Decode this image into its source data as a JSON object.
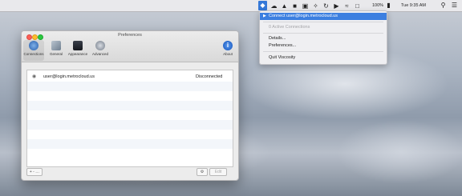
{
  "menubar": {
    "battery": "100%",
    "clock": "Tue 9:35 AM",
    "status_icons": [
      "viscosity-icon",
      "cloud-icon",
      "shield-icon",
      "dropbox-icon",
      "display-icon",
      "bluetooth-icon",
      "timemachine-icon",
      "volume-icon",
      "wifi-icon",
      "input-icon"
    ]
  },
  "dropdown": {
    "connect_item": "Connect user@login.metrocloud.us",
    "active_connections": "0 Active Connections",
    "details": "Details...",
    "preferences": "Preferences...",
    "quit": "Quit Viscosity"
  },
  "window": {
    "title": "Preferences",
    "toolbar": {
      "connections": "Connections",
      "general": "General",
      "appearance": "Appearance",
      "advanced": "Advanced",
      "about": "About"
    },
    "connections": [
      {
        "name": "user@login.metrocloud.us",
        "status": "Disconnected"
      }
    ],
    "bottom": {
      "add_remove": "+ - …",
      "settings": "⚙",
      "edit": "Edit"
    }
  },
  "colors": {
    "highlight": "#3c7fe0",
    "menubar": "#ececee"
  }
}
